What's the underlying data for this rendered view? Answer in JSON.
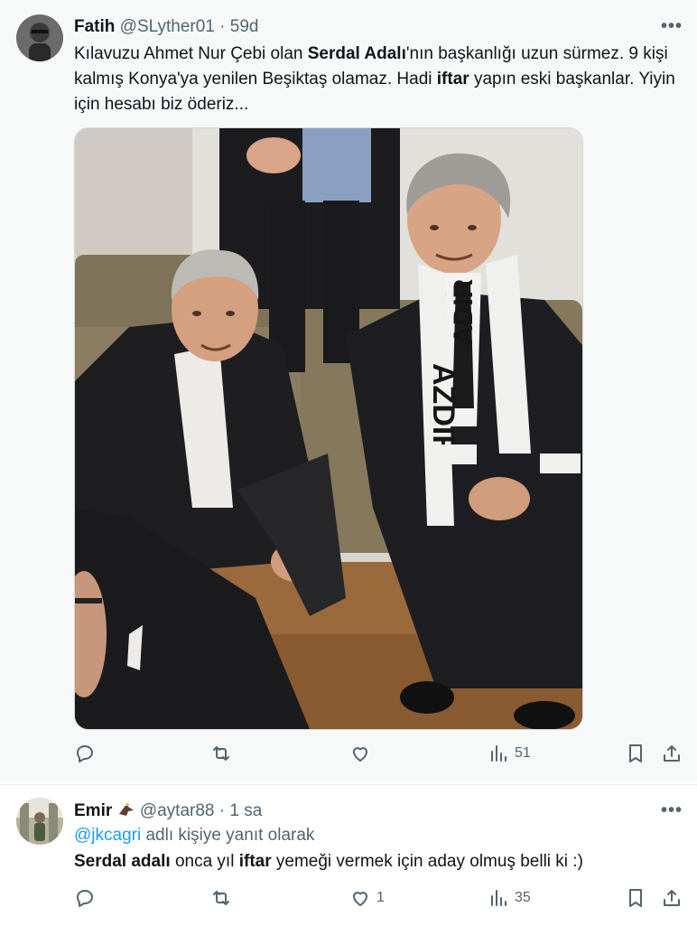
{
  "tweet1": {
    "name": "Fatih",
    "handle": "@SLyther01",
    "separator": "·",
    "time": "59d",
    "more": "•••",
    "text_parts": {
      "p1": "Kılavuzu Ahmet Nur Çebi olan ",
      "b1": "Serdal Adalı",
      "p2": "'nın başkanlığı uzun sürmez.  9 kişi kalmış Konya'ya yenilen Beşiktaş olamaz. Hadi ",
      "b2": "iftar",
      "p3": " yapın eski başkanlar. Yiyin için hesabı biz öderiz..."
    },
    "scarf_text_1": "ADIR",
    "scarf_text_2": "AZDIR",
    "actions": {
      "reply_count": "",
      "retweet_count": "",
      "like_count": "",
      "views_count": "51"
    }
  },
  "tweet2": {
    "name": "Emir",
    "handle": "@aytar88",
    "separator": "·",
    "time": "1 sa",
    "more": "•••",
    "reply_prefix": "@jkcagri",
    "reply_suffix": " adlı kişiye yanıt olarak",
    "text_parts": {
      "b1": "Serdal adalı",
      "p1": " onca yıl ",
      "b2": "iftar",
      "p2": " yemeği vermek için aday olmuş belli ki :)"
    },
    "actions": {
      "reply_count": "",
      "retweet_count": "",
      "like_count": "1",
      "views_count": "35"
    }
  },
  "icons": [
    "reply-icon",
    "retweet-icon",
    "like-icon",
    "views-icon",
    "bookmark-icon",
    "share-icon",
    "more-icon",
    "eagle-emoji-icon"
  ]
}
